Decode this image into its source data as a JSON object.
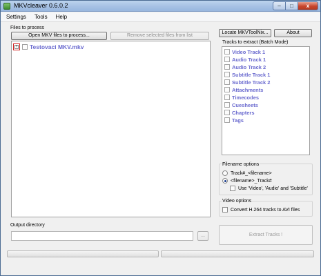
{
  "window": {
    "title": "MKVcleaver 0.6.0.2"
  },
  "menu": {
    "items": [
      "Settings",
      "Tools",
      "Help"
    ]
  },
  "files": {
    "group_label": "Files to process",
    "open_button": "Open MKV files to process...",
    "remove_button": "Remove selected files from list",
    "tree_items": [
      {
        "label": "Testovaci MKV.mkv",
        "expander": "+"
      }
    ]
  },
  "tools": {
    "locate_button": "Locate MKVToolNix...",
    "about_button": "About"
  },
  "tracks": {
    "group_label": "Tracks to extract (Batch Mode)",
    "items": [
      "Video Track 1",
      "Audio Track 1",
      "Audio Track 2",
      "Subtitle Track 1",
      "Subtitle Track 2",
      "Attachments",
      "Timecodes",
      "Cuesheets",
      "Chapters",
      "Tags"
    ]
  },
  "filename_options": {
    "label": "Filename options",
    "radio1": "Track#_<filename>",
    "radio2": "<filename>_Track#",
    "selected": 2,
    "checkbox": "Use 'Video', 'Audio' and 'Subtitle'"
  },
  "video_options": {
    "label": "Video options",
    "checkbox": "Convert H.264 tracks to AVI files"
  },
  "output": {
    "label": "Output directory",
    "value": "",
    "browse_button": "..."
  },
  "extract_button": "Extract Tracks !",
  "window_buttons": {
    "min": "–",
    "max": "□",
    "close": "x"
  }
}
